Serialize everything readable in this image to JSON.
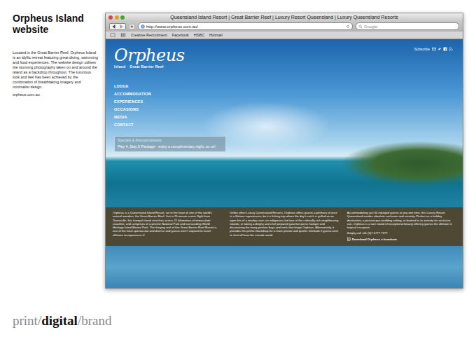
{
  "page": {
    "title": "Orpheus Island website",
    "description": "Located in the Great Barrier Reef, Orpheus Island is an idyllic retreat featuring great diving, swimming and food experiences. The website design utilises the stunning photography taken on and around the island as a backdrop throughout. The luxurious look and feel has been achieved by the combination of breathtaking imagery and minimalist design.",
    "link": "orpheus.com.au"
  },
  "brand_logo": [
    {
      "text": "print",
      "bold": false
    },
    {
      "text": "/",
      "bold": false
    },
    {
      "text": "digital",
      "bold": true
    },
    {
      "text": "/",
      "bold": false
    },
    {
      "text": "brand",
      "bold": false
    }
  ],
  "browser": {
    "title": "Queensland Island Resort | Great Barrier Reef | Luxury Resort Queensland | Luxury Queensland Resorts",
    "address": "http://www.orpheus.com.au/",
    "search_placeholder": "Google",
    "bookmarks": [
      "Creative Recruitment",
      "Facebook",
      "HSBC",
      "Hotmail"
    ]
  },
  "site": {
    "logo": {
      "name": "Orpheus",
      "tagline_left": "Island",
      "tagline_right": "Great Barrier Reef"
    },
    "subscribe": "Subscribe",
    "nav": [
      "LODGE",
      "ACCOMMODATION",
      "EXPERIENCES",
      "OCCASIONS",
      "MEDIA",
      "CONTACT"
    ],
    "specials": {
      "title": "Specials & Announcements",
      "text": "Play 4, Stay 5 Package - enjoy a complimentary night, on us!"
    },
    "columns": [
      {
        "paragraphs": [
          "Orpheus is a Queensland Island Resort, set in the heart of one of the world's natural wonders, the Great Barrier Reef. Just a 25 minute scenic flight from Townsville, this tranquil island stretches across 11 kilometres of immaculate coastline, and comprises of a pristine National Park and surrounding World Heritage listed Marine Park. The fringing reef of this Great Barrier Reef Resort is one of the most spectacular and diverse and guests aren't required to travel offshore to experience it!"
        ],
        "link": ""
      },
      {
        "paragraphs": [
          "Unlike other Luxury Queensland Resorts, Orpheus offers guests a plethora of once in a lifetime experiences; be it a fishing trip where the day's catch is grilled on an open fire of a nearby cove; an indigenous-led tour of the culturally-rich neighbouring islands; or taking a dinghy and chef prepared gourmet picnic hamper and discovering the many pristine bays and reefs that fringe Orpheus. Alternatively, it provides the perfect backdrop for a more private and quieter interlude if guests wish to shut off from the outside world."
        ],
        "link": ""
      },
      {
        "paragraphs": [
          "Accommodating just 34 indulged guests at any one time, this Luxury Resort Queensland exudes absolute seclusion and serenity. Perfect as a holiday destination, a picturesque wedding setting, or booked in its entirety for exclusive use, Orpheus is a rare island of exceptional beauty offering guests the ultimate in tropical escapism.",
          "Simply call +61 (0)7 4777 7377"
        ],
        "link": "Download Orpheus e-brochure"
      }
    ]
  }
}
